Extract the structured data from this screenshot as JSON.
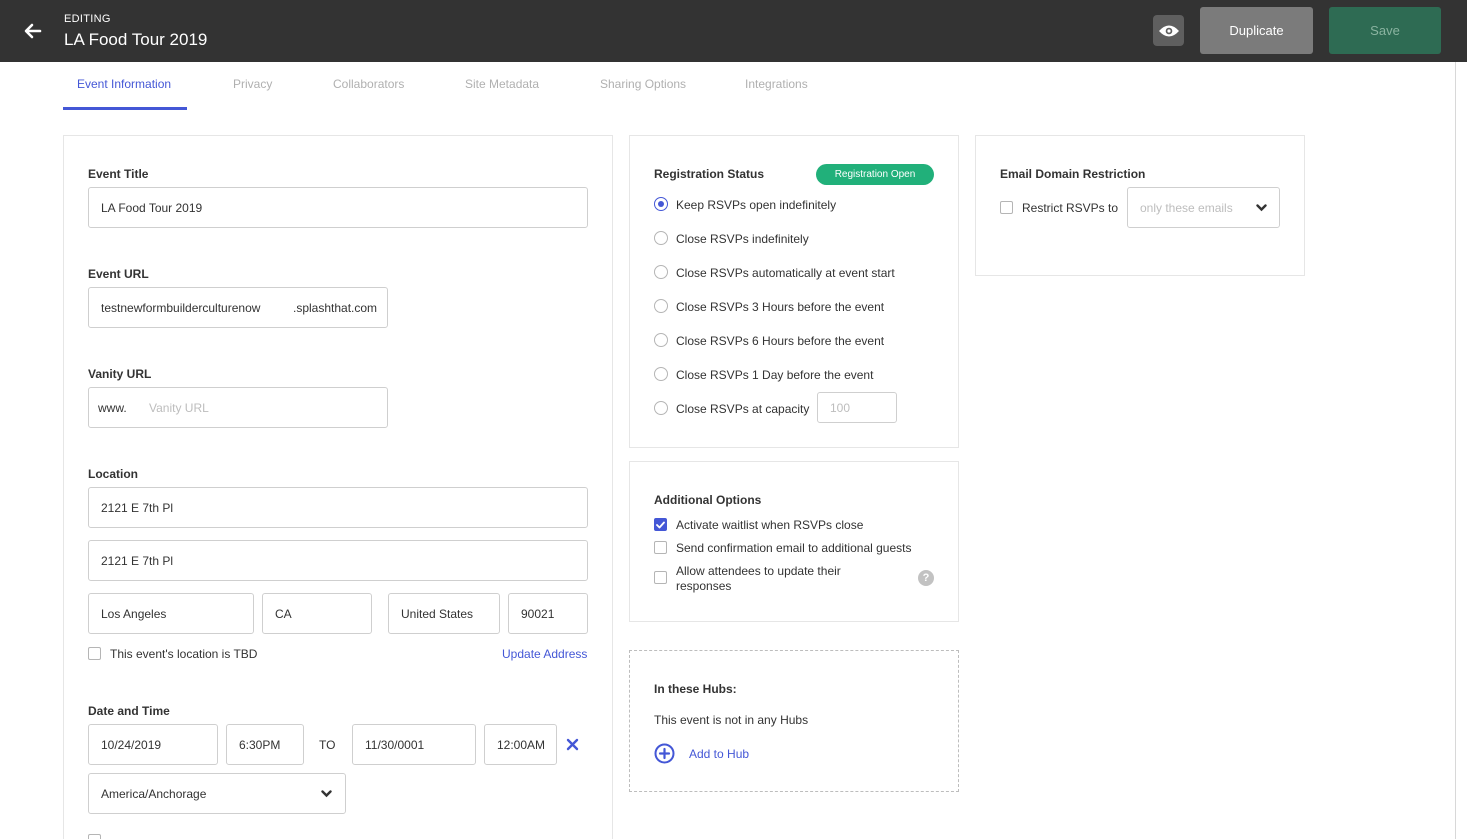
{
  "header": {
    "editing_label": "EDITING",
    "title": "LA Food Tour 2019",
    "duplicate_label": "Duplicate",
    "save_label": "Save"
  },
  "tabs": [
    {
      "label": "Event Information",
      "active": true
    },
    {
      "label": "Privacy"
    },
    {
      "label": "Collaborators"
    },
    {
      "label": "Site Metadata"
    },
    {
      "label": "Sharing Options"
    },
    {
      "label": "Integrations"
    }
  ],
  "event_info": {
    "event_title_label": "Event Title",
    "event_title_value": "LA Food Tour 2019",
    "event_url_label": "Event URL",
    "event_url_value": "testnewformbuilderculturenow",
    "event_url_suffix": ".splashthat.com",
    "vanity_label": "Vanity URL",
    "vanity_prefix": "www.",
    "vanity_placeholder": "Vanity URL",
    "location_label": "Location",
    "address1": "2121 E 7th Pl",
    "address2": "2121 E 7th Pl",
    "city": "Los Angeles",
    "state": "CA",
    "country": "United States",
    "zip": "90021",
    "tbd_label": "This event's location is TBD",
    "update_address": "Update Address",
    "date_label": "Date and Time",
    "start_date": "10/24/2019",
    "start_time": "6:30PM",
    "to_label": "TO",
    "end_date": "11/30/0001",
    "end_time": "12:00AM",
    "timezone": "America/Anchorage"
  },
  "registration": {
    "label": "Registration Status",
    "badge": "Registration Open",
    "options": [
      {
        "label": "Keep RSVPs open indefinitely",
        "selected": true
      },
      {
        "label": "Close RSVPs indefinitely"
      },
      {
        "label": "Close RSVPs automatically at event start"
      },
      {
        "label": "Close RSVPs 3 Hours before the event"
      },
      {
        "label": "Close RSVPs 6 Hours before the event"
      },
      {
        "label": "Close RSVPs 1 Day before the event"
      },
      {
        "label": "Close RSVPs at capacity"
      }
    ],
    "capacity_placeholder": "100"
  },
  "additional": {
    "label": "Additional Options",
    "options": [
      {
        "label": "Activate waitlist when RSVPs close",
        "checked": true
      },
      {
        "label": "Send confirmation email to additional guests",
        "checked": false
      },
      {
        "label": "Allow attendees to update their",
        "label_line2": "responses",
        "checked": false
      }
    ],
    "help": "?"
  },
  "hubs": {
    "label": "In these Hubs:",
    "status": "This event is not in any Hubs",
    "add_label": "Add to Hub"
  },
  "email_domain": {
    "label": "Email Domain Restriction",
    "restrict_label": "Restrict RSVPs to",
    "select_placeholder": "only these emails"
  },
  "colors": {
    "accent": "#4457d6",
    "header_bg": "#333333",
    "save_bg": "#2e6b53",
    "badge_green": "#21b07a"
  }
}
